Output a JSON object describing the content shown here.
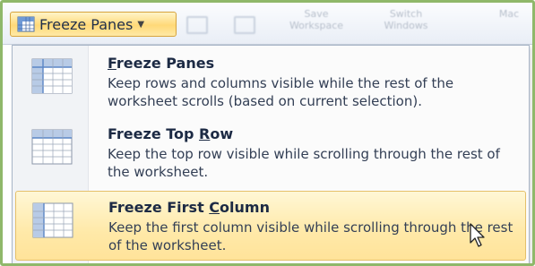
{
  "toolbar": {
    "freeze_panes_button": "Freeze Panes",
    "ghost_buttons": [
      {
        "line1": "Save",
        "line2": "Workspace"
      },
      {
        "line1": "Switch",
        "line2": "Windows"
      },
      {
        "line1": "Mac",
        "line2": ""
      }
    ]
  },
  "menu": {
    "items": [
      {
        "title_pre": "",
        "title_key": "F",
        "title_post": "reeze Panes",
        "description": "Keep rows and columns visible while the rest of the worksheet scrolls (based on current selection).",
        "icon": "freeze-panes-icon",
        "highlighted": false
      },
      {
        "title_pre": "Freeze Top ",
        "title_key": "R",
        "title_post": "ow",
        "description": "Keep the top row visible while scrolling through the rest of the worksheet.",
        "icon": "freeze-top-row-icon",
        "highlighted": false
      },
      {
        "title_pre": "Freeze First ",
        "title_key": "C",
        "title_post": "olumn",
        "description": "Keep the first column visible while scrolling through the rest of the worksheet.",
        "icon": "freeze-first-column-icon",
        "highlighted": true
      }
    ]
  },
  "colors": {
    "frame_border": "#8fb86a",
    "highlight_fill": "#ffe9a8",
    "highlight_border": "#e5c06a",
    "grid_blue": "#5b86c5"
  }
}
